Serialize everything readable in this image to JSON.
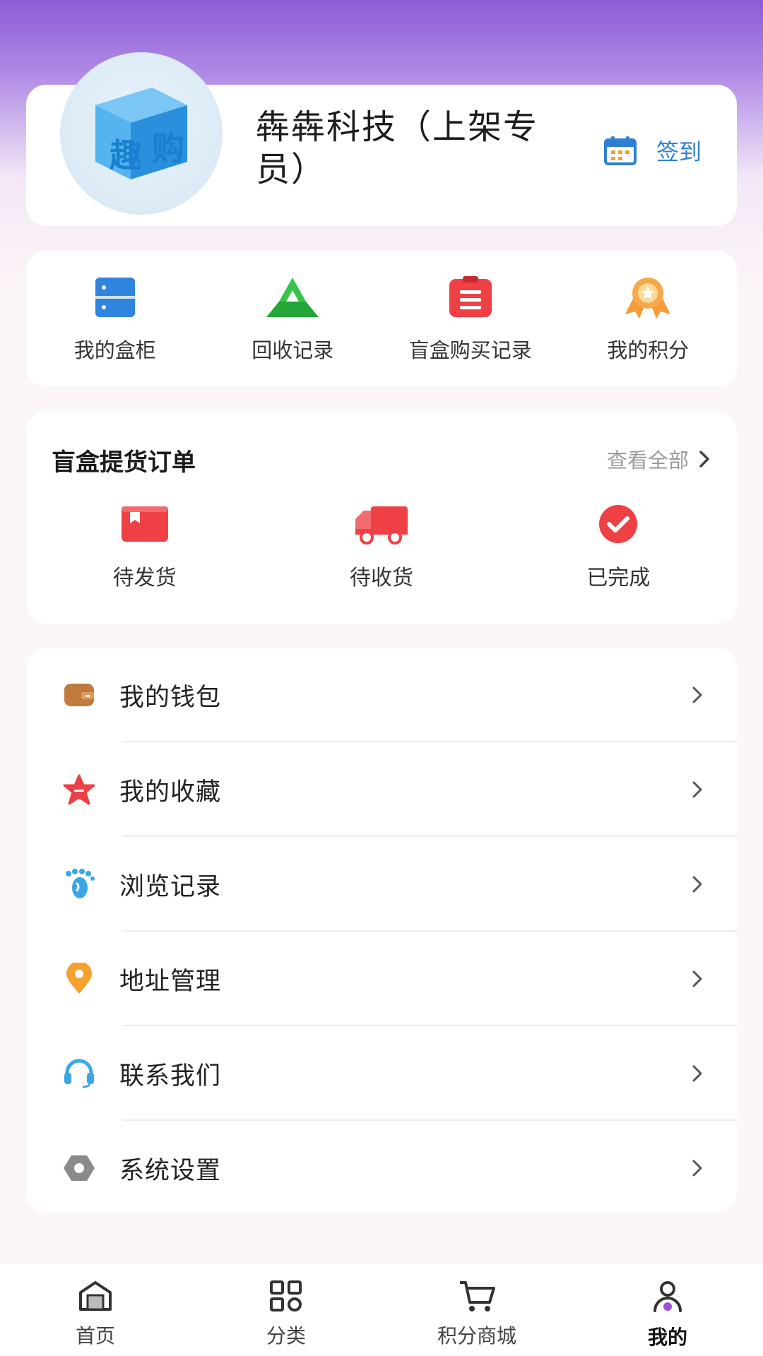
{
  "profile": {
    "user_name": "犇犇科技（上架专员）",
    "avatar_text_1": "趣",
    "avatar_text_2": "购",
    "signin_label": "签到"
  },
  "quick_actions": [
    {
      "label": "我的盒柜",
      "icon": "cabinet-icon"
    },
    {
      "label": "回收记录",
      "icon": "recycle-icon"
    },
    {
      "label": "盲盒购买记录",
      "icon": "clipboard-icon"
    },
    {
      "label": "我的积分",
      "icon": "medal-icon"
    }
  ],
  "orders": {
    "title": "盲盒提货订单",
    "view_all": "查看全部",
    "items": [
      {
        "label": "待发货",
        "icon": "package-icon"
      },
      {
        "label": "待收货",
        "icon": "truck-icon"
      },
      {
        "label": "已完成",
        "icon": "check-circle-icon"
      }
    ]
  },
  "menu": [
    {
      "label": "我的钱包",
      "icon": "wallet-icon"
    },
    {
      "label": "我的收藏",
      "icon": "star-icon"
    },
    {
      "label": "浏览记录",
      "icon": "footprint-icon"
    },
    {
      "label": "地址管理",
      "icon": "location-icon"
    },
    {
      "label": "联系我们",
      "icon": "headset-icon"
    },
    {
      "label": "系统设置",
      "icon": "settings-icon"
    }
  ],
  "bottom_nav": [
    {
      "label": "首页",
      "icon": "home-icon"
    },
    {
      "label": "分类",
      "icon": "category-icon"
    },
    {
      "label": "积分商城",
      "icon": "cart-icon"
    },
    {
      "label": "我的",
      "icon": "profile-icon",
      "active": true
    }
  ],
  "colors": {
    "accent_blue": "#2f7fd4",
    "header_purple": "#8e5bd6",
    "red": "#ee4045",
    "green": "#2fb344",
    "orange": "#f4a12e"
  }
}
